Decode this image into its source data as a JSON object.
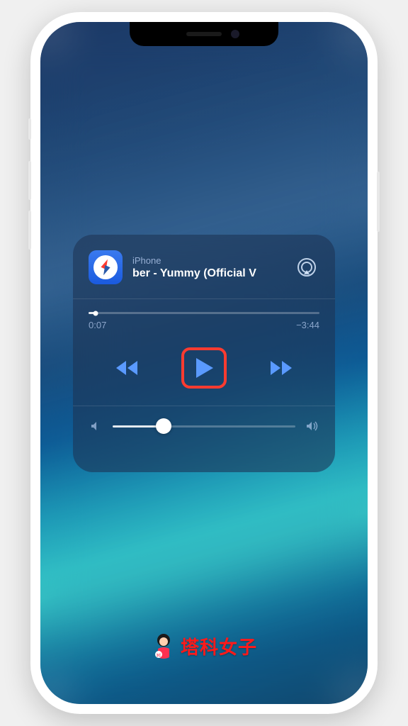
{
  "media": {
    "source": "iPhone",
    "title": "ber - Yummy (Official V",
    "elapsed": "0:07",
    "remaining": "−3:44",
    "progress_pct": 3,
    "volume_pct": 28
  },
  "watermark": {
    "text": "塔科女子"
  },
  "colors": {
    "highlight": "#ff3b30",
    "accent": "#5a9aff"
  }
}
